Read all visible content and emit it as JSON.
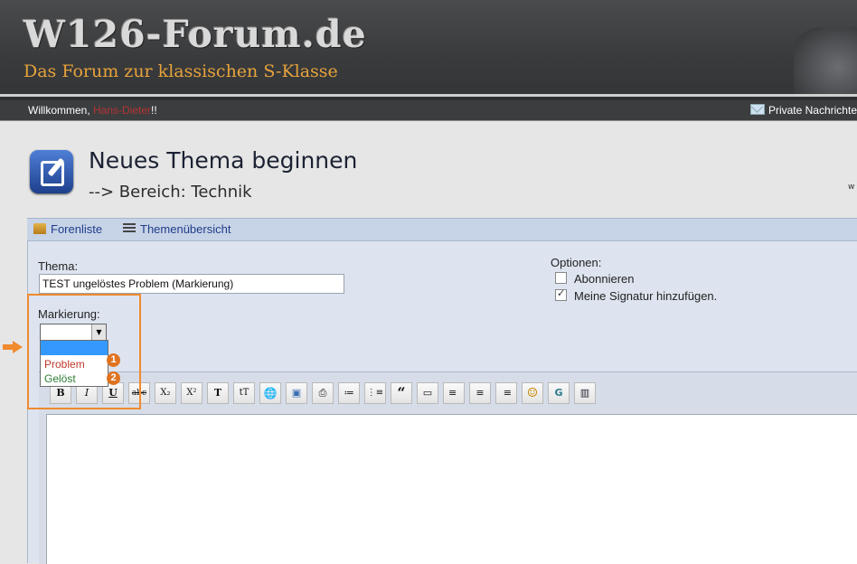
{
  "header": {
    "logo_title": "W126-Forum.de",
    "logo_subtitle": "Das Forum zur klassischen S-Klasse"
  },
  "welcome_bar": {
    "greeting": "Willkommen, ",
    "username": "Hans-Dieter",
    "suffix": "!!",
    "private_messages": "Private Nachrichte"
  },
  "page": {
    "title": "Neues Thema beginnen",
    "subtitle": "--> Bereich: Technik",
    "side_text": "w"
  },
  "nav": {
    "items": [
      {
        "label": "Forenliste",
        "icon": "home-icon"
      },
      {
        "label": "Themenübersicht",
        "icon": "list-icon"
      }
    ]
  },
  "form": {
    "thema_label": "Thema:",
    "thema_value": "TEST ungelöstes Problem (Markierung)",
    "markierung_label": "Markierung:",
    "markierung_options": [
      "",
      "Problem",
      "Gelöst"
    ],
    "markierung_selected": "",
    "options_label": "Optionen:",
    "options": [
      {
        "label": "Abonnieren",
        "checked": false
      },
      {
        "label": "Meine Signatur hinzufügen.",
        "checked": true
      }
    ]
  },
  "annotations": {
    "badge_1": "1",
    "badge_2": "2",
    "accent_color": "#f08a2e"
  },
  "toolbar": {
    "buttons": [
      {
        "name": "bold-button",
        "glyph": "B"
      },
      {
        "name": "italic-button",
        "glyph": "I"
      },
      {
        "name": "underline-button",
        "glyph": "U"
      },
      {
        "name": "strikethrough-button",
        "glyph": "abc"
      },
      {
        "name": "subscript-button",
        "glyph": "X₂"
      },
      {
        "name": "superscript-button",
        "glyph": "X²"
      },
      {
        "name": "font-color-button",
        "glyph": "T"
      },
      {
        "name": "font-size-button",
        "glyph": "tT"
      },
      {
        "name": "link-button",
        "glyph": "🌐"
      },
      {
        "name": "image-button",
        "glyph": "▣"
      },
      {
        "name": "attachment-button",
        "glyph": "⎙"
      },
      {
        "name": "bullet-list-button",
        "glyph": "≔"
      },
      {
        "name": "numbered-list-button",
        "glyph": "⋮≡"
      },
      {
        "name": "quote-button",
        "glyph": "“"
      },
      {
        "name": "code-button",
        "glyph": "▭"
      },
      {
        "name": "align-left-button",
        "glyph": "≡"
      },
      {
        "name": "align-center-button",
        "glyph": "≡"
      },
      {
        "name": "align-right-button",
        "glyph": "≡"
      },
      {
        "name": "smiley-button",
        "glyph": "☺"
      },
      {
        "name": "google-button",
        "glyph": "G"
      },
      {
        "name": "video-button",
        "glyph": "▥"
      }
    ]
  }
}
